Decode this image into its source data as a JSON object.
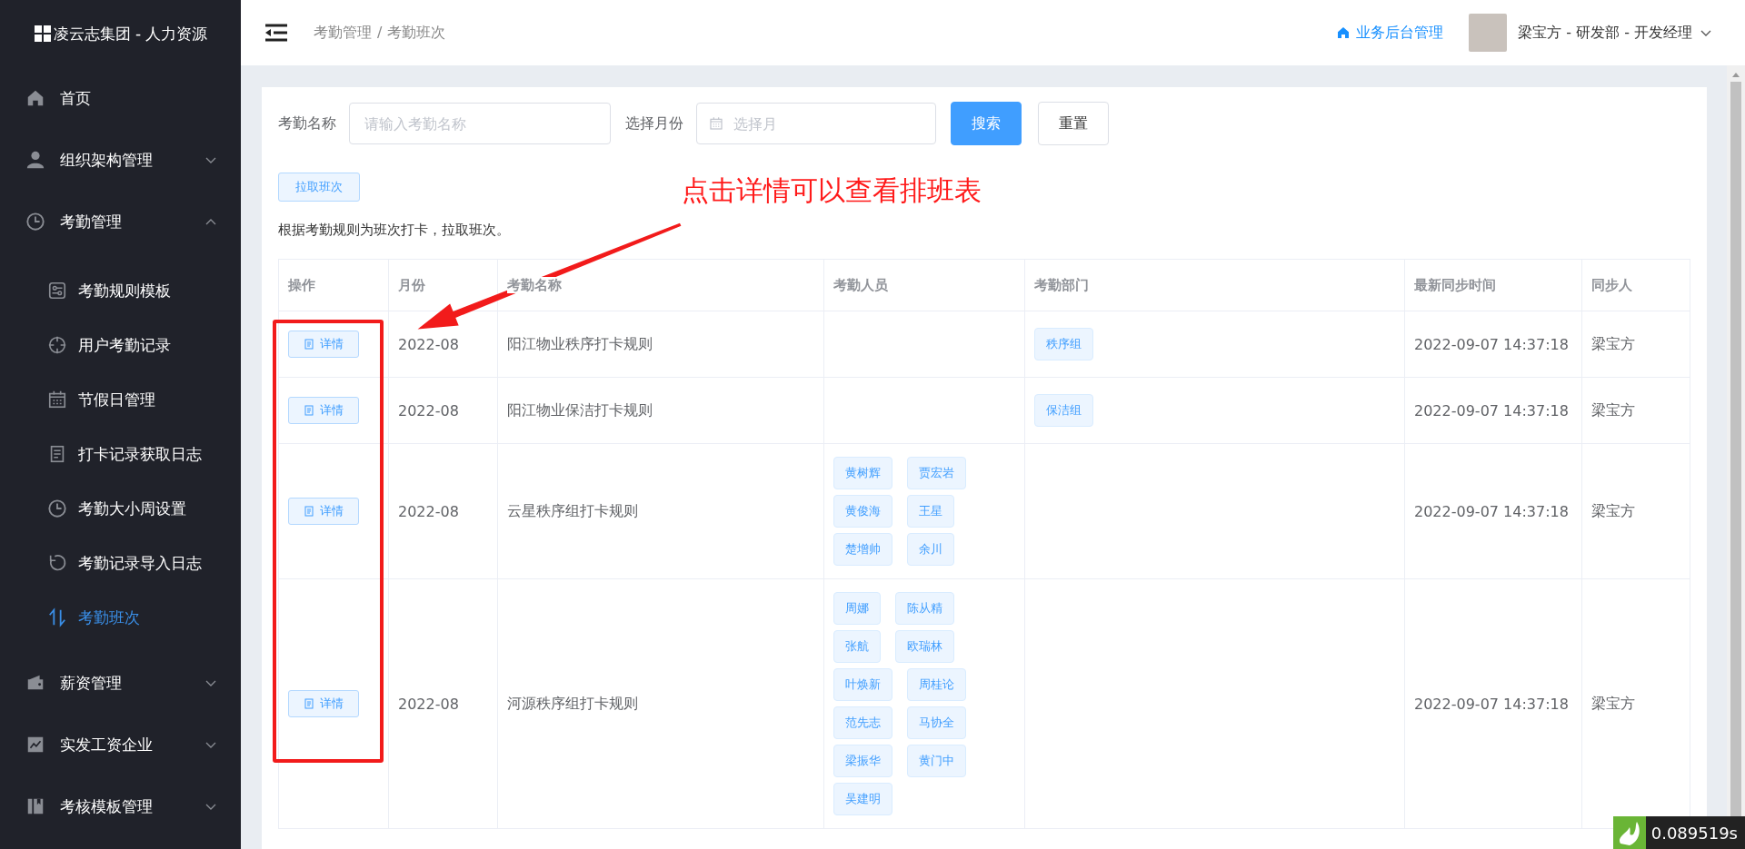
{
  "sidebar": {
    "title": "凌云志集团 - 人力资源",
    "items": [
      {
        "label": "首页",
        "has_children": false
      },
      {
        "label": "组织架构管理",
        "expanded": false,
        "has_children": true
      },
      {
        "label": "考勤管理",
        "expanded": true,
        "has_children": true,
        "children": [
          {
            "label": "考勤规则模板",
            "selected": false
          },
          {
            "label": "用户考勤记录",
            "selected": false
          },
          {
            "label": "节假日管理",
            "selected": false
          },
          {
            "label": "打卡记录获取日志",
            "selected": false
          },
          {
            "label": "考勤大小周设置",
            "selected": false
          },
          {
            "label": "考勤记录导入日志",
            "selected": false
          },
          {
            "label": "考勤班次",
            "selected": true
          }
        ]
      },
      {
        "label": "薪资管理",
        "expanded": false,
        "has_children": true
      },
      {
        "label": "实发工资企业",
        "expanded": false,
        "has_children": true
      },
      {
        "label": "考核模板管理",
        "expanded": false,
        "has_children": true
      }
    ]
  },
  "header": {
    "breadcrumb": [
      "考勤管理",
      "考勤班次"
    ],
    "separator": "/",
    "admin_link": "业务后台管理",
    "user": "梁宝方 - 研发部 - 开发经理"
  },
  "filters": {
    "name_label": "考勤名称",
    "name_placeholder": "请输入考勤名称",
    "month_label": "选择月份",
    "month_placeholder": "选择月",
    "search_button": "搜索",
    "reset_button": "重置"
  },
  "pull_button": "拉取班次",
  "note": "根据考勤规则为班次打卡，拉取班次。",
  "annotation": "点击详情可以查看排班表",
  "table": {
    "columns": [
      "操作",
      "月份",
      "考勤名称",
      "考勤人员",
      "考勤部门",
      "最新同步时间",
      "同步人"
    ],
    "rows": [
      {
        "action": "详情",
        "month": "2022-08",
        "name": "阳江物业秩序打卡规则",
        "people": [],
        "departments": [
          "秩序组"
        ],
        "synced_at": "2022-09-07 14:37:18",
        "synced_by": "梁宝方"
      },
      {
        "action": "详情",
        "month": "2022-08",
        "name": "阳江物业保洁打卡规则",
        "people": [],
        "departments": [
          "保洁组"
        ],
        "synced_at": "2022-09-07 14:37:18",
        "synced_by": "梁宝方"
      },
      {
        "action": "详情",
        "month": "2022-08",
        "name": "云星秩序组打卡规则",
        "people": [
          "黄树辉",
          "贾宏岩",
          "黄俊海",
          "王星",
          "楚增帅",
          "余川"
        ],
        "departments": [],
        "synced_at": "2022-09-07 14:37:18",
        "synced_by": "梁宝方"
      },
      {
        "action": "详情",
        "month": "2022-08",
        "name": "河源秩序组打卡规则",
        "people": [
          "周娜",
          "陈从精",
          "张航",
          "欧瑞林",
          "叶焕新",
          "周桂论",
          "范先志",
          "马协全",
          "梁振华",
          "黄门中",
          "吴建明"
        ],
        "departments": [],
        "synced_at": "2022-09-07 14:37:18",
        "synced_by": "梁宝方"
      }
    ]
  },
  "timer": "0.089519s"
}
